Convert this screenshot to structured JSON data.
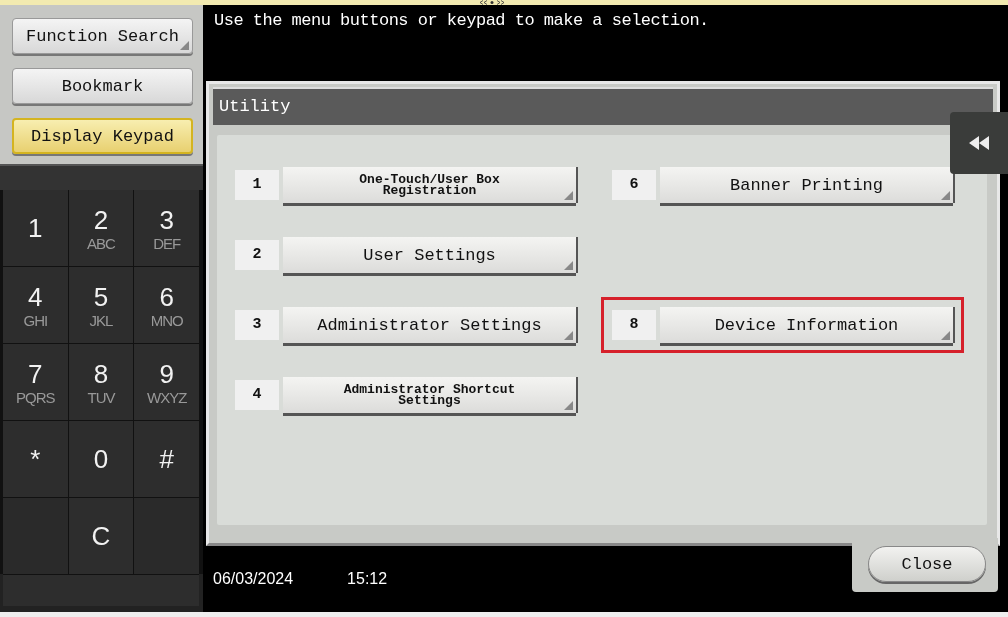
{
  "side_buttons": [
    {
      "label": "Function Search",
      "selected": false,
      "has_submenu": true
    },
    {
      "label": "Bookmark",
      "selected": false,
      "has_submenu": false
    },
    {
      "label": "Display Keypad",
      "selected": true,
      "has_submenu": false
    }
  ],
  "keypad": [
    {
      "kind": "key",
      "digit": "1"
    },
    {
      "digit": "2",
      "letters": "ABC"
    },
    {
      "digit": "3",
      "letters": "DEF"
    },
    {
      "digit": "4",
      "letters": "GHI"
    },
    {
      "digit": "5",
      "letters": "JKL"
    },
    {
      "digit": "6",
      "letters": "MNO"
    },
    {
      "digit": "7",
      "letters": "PQRS"
    },
    {
      "digit": "8",
      "letters": "TUV"
    },
    {
      "digit": "9",
      "letters": "WXYZ"
    },
    {
      "digit": "*"
    },
    {
      "digit": "0"
    },
    {
      "digit": "#"
    },
    {
      "kind": "blank"
    },
    {
      "digit": "C"
    },
    {
      "kind": "blank"
    }
  ],
  "message": "Use the menu buttons or keypad to make a selection.",
  "window": {
    "title": "Utility"
  },
  "menu_columns": [
    [
      {
        "kind": "item",
        "number": "1",
        "label": "One-Touch/User Box Registration",
        "small": true,
        "highlighted": false
      },
      {
        "kind": "item",
        "number": "2",
        "label": "User Settings",
        "small": false,
        "highlighted": false
      },
      {
        "kind": "item",
        "number": "3",
        "label": "Administrator Settings",
        "small": false,
        "highlighted": false
      },
      {
        "kind": "item",
        "number": "4",
        "label": "Administrator Shortcut Settings",
        "small": true,
        "highlighted": false
      }
    ],
    [
      {
        "kind": "item",
        "number": "6",
        "label": "Banner Printing",
        "small": false,
        "highlighted": false
      },
      {
        "kind": "blank"
      },
      {
        "kind": "item",
        "number": "8",
        "label": "Device Information",
        "small": false,
        "highlighted": true
      },
      {
        "kind": "blank"
      }
    ]
  ],
  "status_bar": {
    "date": "06/03/2024",
    "time": "15:12"
  },
  "close_button": "Close"
}
